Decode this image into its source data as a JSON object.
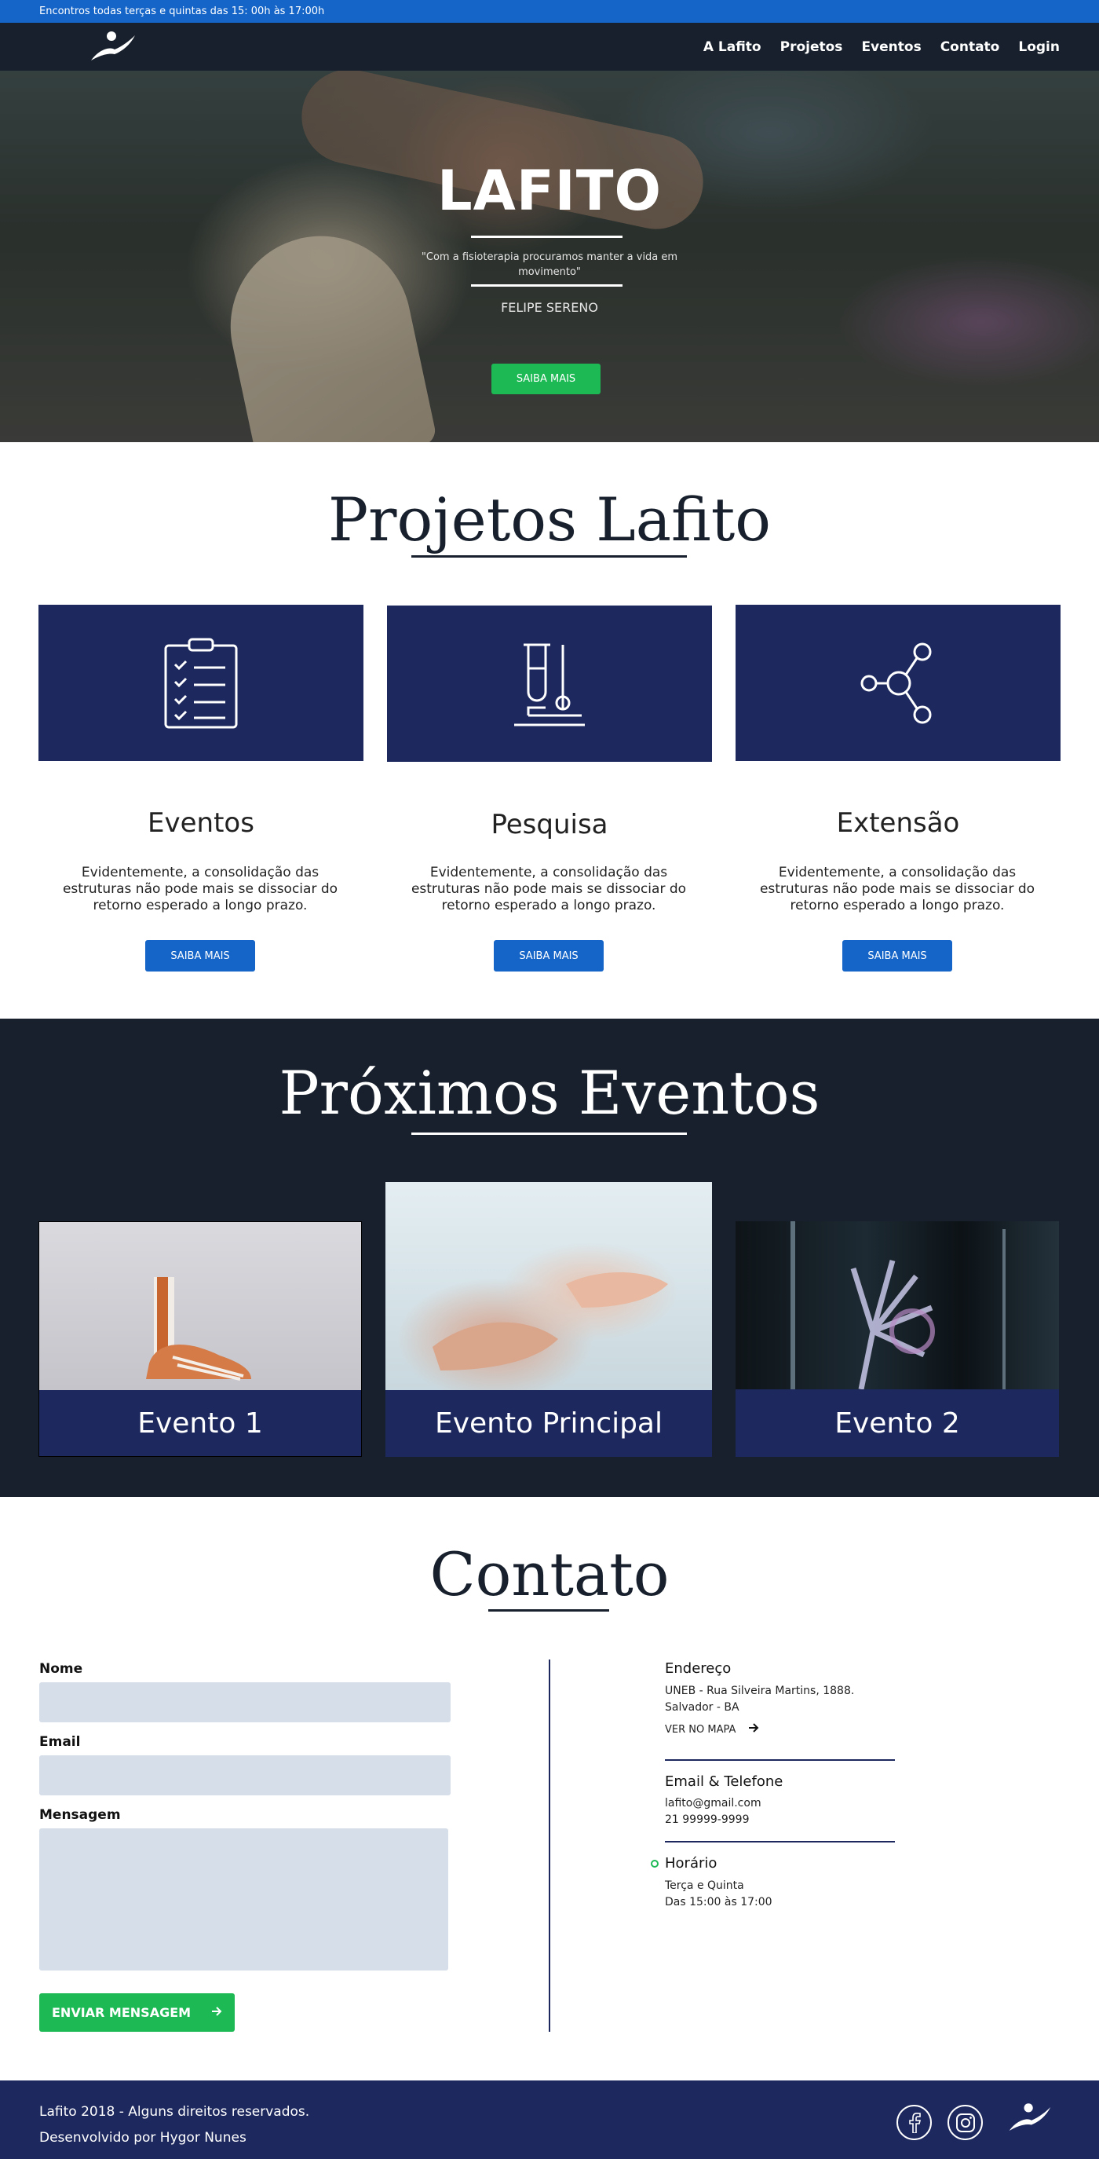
{
  "topbar": {
    "text": "Encontros todas terças e quintas das 15: 00h às 17:00h"
  },
  "nav": {
    "logo_icon": "lafito-runner-logo",
    "links": [
      "A Lafito",
      "Projetos",
      "Eventos",
      "Contato",
      "Login"
    ]
  },
  "hero": {
    "title": "LAFITO",
    "quote": "\"Com a fisioterapia procuramos manter a vida em movimento\"",
    "author": "FELIPE SERENO",
    "button": "SAIBA MAIS"
  },
  "projects": {
    "title": "Projetos Lafito",
    "cards": [
      {
        "icon": "checklist-clipboard-icon",
        "name": "Eventos",
        "description": "Evidentemente, a consolidação das estruturas não pode mais se dissociar do retorno esperado a longo prazo.",
        "button": "SAIBA MAIS"
      },
      {
        "icon": "lab-test-tube-icon",
        "name": "Pesquisa",
        "description": "Evidentemente, a consolidação das estruturas não pode mais se dissociar do retorno esperado a longo prazo.",
        "button": "SAIBA MAIS"
      },
      {
        "icon": "share-network-icon",
        "name": "Extensão",
        "description": "Evidentemente, a consolidação das estruturas não pode mais se dissociar do retorno esperado a longo prazo.",
        "button": "SAIBA MAIS"
      }
    ]
  },
  "events": {
    "title": "Próximos Eventos",
    "items": [
      {
        "label": "Evento 1",
        "image": "foot-skeleton-model-photo"
      },
      {
        "label": "Evento Principal",
        "image": "back-massage-photo"
      },
      {
        "label": "Evento 2",
        "image": "hand-xray-photo"
      }
    ]
  },
  "contact": {
    "title": "Contato",
    "form": {
      "name_label": "Nome",
      "email_label": "Email",
      "message_label": "Mensagem",
      "name_value": "",
      "email_value": "",
      "message_value": "",
      "submit": "ENVIAR MENSAGEM"
    },
    "address": {
      "heading": "Endereço",
      "line1": "UNEB - Rua Silveira Martins, 1888.",
      "line2": "Salvador - BA",
      "map_link": "VER NO MAPA"
    },
    "phone": {
      "heading": "Email & Telefone",
      "email": "lafito@gmail.com",
      "phone": "21 99999-9999"
    },
    "hours": {
      "heading": "Horário",
      "days": "Terça e Quinta",
      "time": "Das 15:00 às 17:00"
    }
  },
  "footer": {
    "copyright": "Lafito 2018 - Alguns direitos reservados.",
    "developer": "Desenvolvido por Hygor Nunes",
    "social": [
      "facebook-icon",
      "instagram-icon"
    ]
  },
  "colors": {
    "primary_blue": "#1565c8",
    "navy": "#1d285e",
    "dark": "#17202c",
    "green": "#1db954",
    "input_bg": "#d5dee9"
  }
}
